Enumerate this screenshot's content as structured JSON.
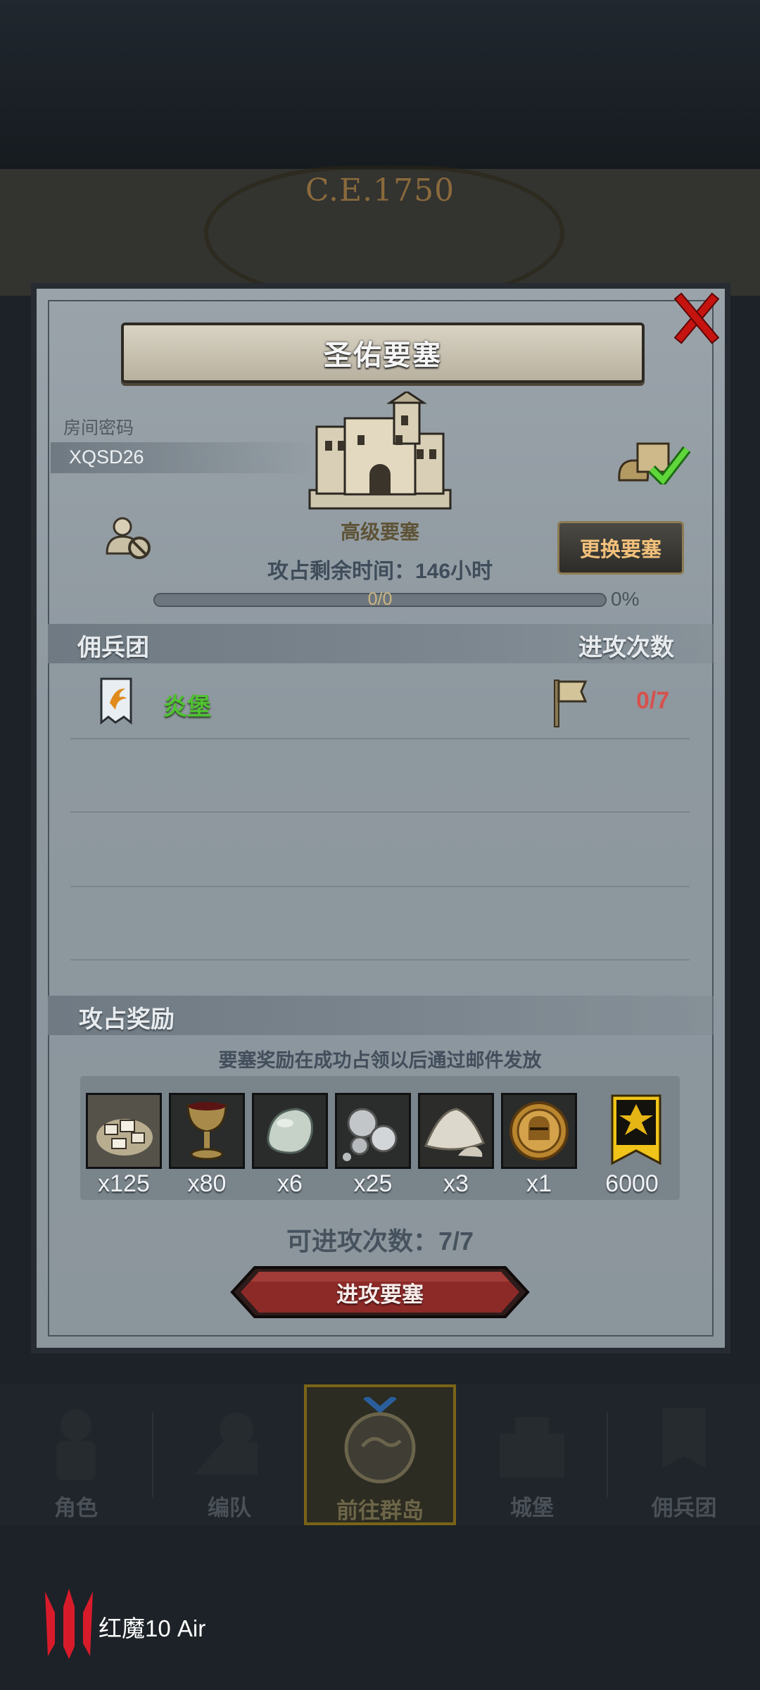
{
  "background": {
    "era": "C.E.1750"
  },
  "dialog": {
    "title": "圣佑要塞",
    "room_label": "房间密码",
    "room_code": "XQSD26",
    "fort_level": "高级要塞",
    "change_button": "更换要塞",
    "time_left": "攻占剩余时间：146小时",
    "progress": {
      "text": "0/0",
      "percent": "0%",
      "fraction": 0
    },
    "mercenary_header": "佣兵团",
    "attack_count_header": "进攻次数",
    "mercenaries": [
      {
        "name": "炎堡",
        "attacks": "0/7"
      }
    ],
    "rewards_header": "攻占奖励",
    "rewards_note": "要塞奖励在成功占领以后通过邮件发放",
    "rewards": [
      {
        "icon": "stone-blocks-icon",
        "qty": "x125"
      },
      {
        "icon": "goblet-icon",
        "qty": "x80"
      },
      {
        "icon": "pale-gem-icon",
        "qty": "x6"
      },
      {
        "icon": "silver-ore-icon",
        "qty": "x25"
      },
      {
        "icon": "salt-pile-icon",
        "qty": "x3"
      },
      {
        "icon": "knight-medal-icon",
        "qty": "x1"
      },
      {
        "icon": "guild-banner-icon",
        "qty": "6000"
      }
    ],
    "attacks_available": "可进攻次数：7/7",
    "attack_button": "进攻要塞"
  },
  "nav": [
    {
      "label": "角色",
      "icon": "knight-icon",
      "active": false
    },
    {
      "label": "编队",
      "icon": "formation-icon",
      "active": false
    },
    {
      "label": "前往群岛",
      "icon": "globe-icon",
      "active": true
    },
    {
      "label": "城堡",
      "icon": "castle-icon",
      "active": false
    },
    {
      "label": "佣兵团",
      "icon": "mercenary-icon",
      "active": false
    }
  ],
  "watermark": {
    "text": "红魔10 Air"
  },
  "colors": {
    "panel": "#8e989f",
    "merc_name": "#4fc330",
    "attack_count": "#d6514d",
    "change_button_text": "#f3c17b",
    "attack_button": "#8c2a28"
  }
}
